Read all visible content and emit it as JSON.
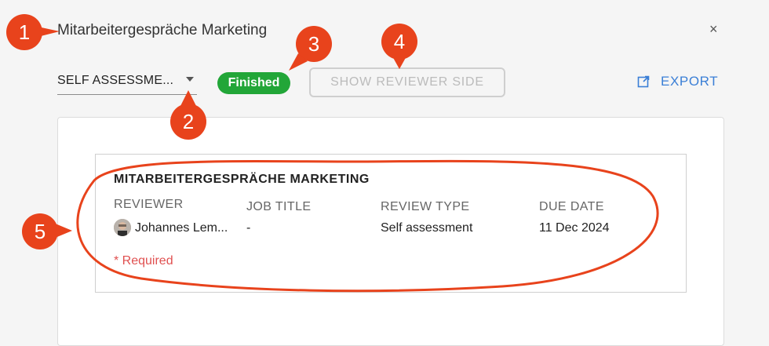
{
  "dialog": {
    "title": "Mitarbeitergespräche Marketing",
    "close_label": "×"
  },
  "toolbar": {
    "select_value": "SELF ASSESSME...",
    "status_badge": "Finished",
    "reviewer_side_button": "SHOW REVIEWER SIDE",
    "export_label": "EXPORT"
  },
  "card": {
    "title": "MITARBEITERGESPRÄCHE MARKETING",
    "columns": {
      "reviewer_label": "REVIEWER",
      "reviewer_value": "Johannes Lem...",
      "job_title_label": "JOB TITLE",
      "job_title_value": "-",
      "review_type_label": "REVIEW TYPE",
      "review_type_value": "Self assessment",
      "due_date_label": "DUE DATE",
      "due_date_value": "11 Dec 2024"
    },
    "required_note": "* Required"
  },
  "callouts": [
    "1",
    "2",
    "3",
    "4",
    "5"
  ],
  "colors": {
    "callout": "#e8431c",
    "badge": "#22a638",
    "link": "#3b7fd6",
    "required": "#e05050"
  }
}
